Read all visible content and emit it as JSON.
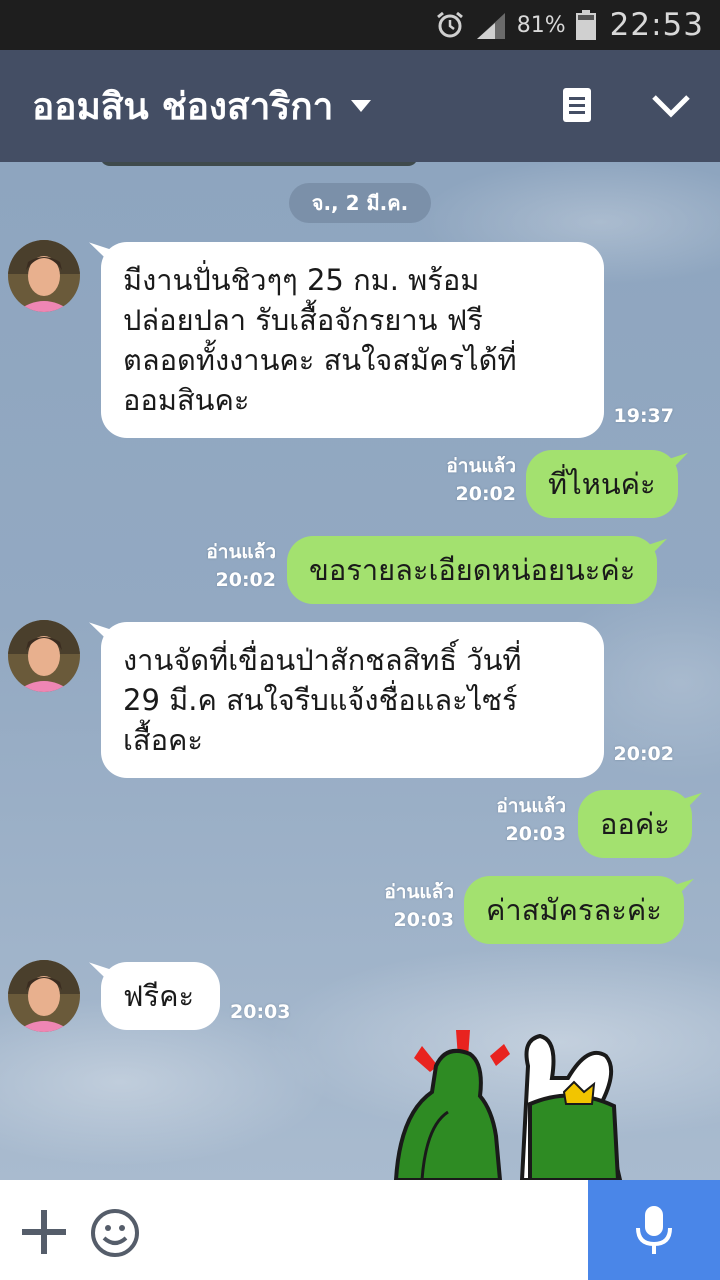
{
  "status_bar": {
    "battery_percent": "81%",
    "time": "22:53",
    "icons": [
      "alarm-icon",
      "signal-icon",
      "battery-icon"
    ]
  },
  "header": {
    "title": "ออมสิน ช่องสาริกา",
    "icons": [
      "chevron-down-icon",
      "notes-icon",
      "collapse-icon"
    ]
  },
  "chat": {
    "date_label": "จ., 2 มี.ค.",
    "messages": [
      {
        "direction": "incoming",
        "text": "มีงานปั่นชิวๆๆ 25 กม. พร้อม\nปล่อยปลา รับเสื้อจักรยาน ฟรี\nตลอดทั้งงานคะ สนใจสมัครได้ที่\nออมสินคะ",
        "time": "19:37"
      },
      {
        "direction": "outgoing",
        "text": "ที่ไหนค่ะ",
        "read": "อ่านแล้ว",
        "time": "20:02"
      },
      {
        "direction": "outgoing",
        "text": "ขอรายละเอียดหน่อยนะค่ะ",
        "read": "อ่านแล้ว",
        "time": "20:02"
      },
      {
        "direction": "incoming",
        "text": "งานจัดที่เขื่อนป่าสักชลสิทธิ์ วันที่\n29 มี.ค สนใจรีบแจ้งชื่อและไซร์\nเสื้อคะ",
        "time": "20:02"
      },
      {
        "direction": "outgoing",
        "text": "ออค่ะ",
        "read": "อ่านแล้ว",
        "time": "20:03"
      },
      {
        "direction": "outgoing",
        "text": "ค่าสมัครละค่ะ",
        "read": "อ่านแล้ว",
        "time": "20:03"
      },
      {
        "direction": "incoming",
        "text": "ฟรีคะ",
        "time": "20:03"
      }
    ],
    "sticker": "thumbs-up-sticker"
  },
  "input_bar": {
    "placeholder": "",
    "icons": [
      "plus-icon",
      "emoji-icon",
      "microphone-icon"
    ]
  },
  "colors": {
    "header_bg": "#444e64",
    "outgoing_bubble": "#a3e16f",
    "incoming_bubble": "#ffffff",
    "mic_button": "#4a86e8",
    "status_bar_bg": "#1e1e1e"
  }
}
